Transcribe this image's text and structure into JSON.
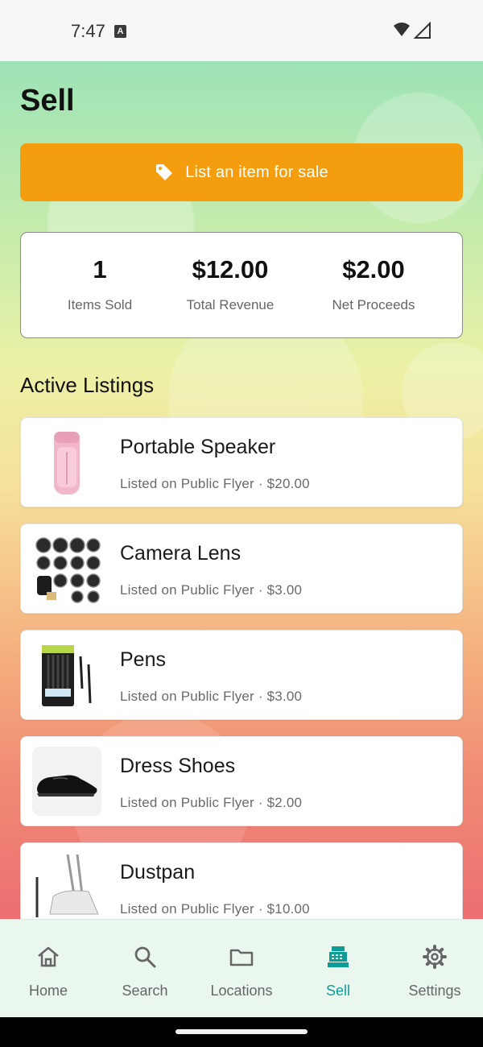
{
  "status_bar": {
    "time": "7:47",
    "notification_letter": "A"
  },
  "header": {
    "title": "Sell"
  },
  "cta": {
    "label": "List an item for sale",
    "color": "#f49e0f"
  },
  "stats": [
    {
      "value": "1",
      "label": "Items Sold"
    },
    {
      "value": "$12.00",
      "label": "Total Revenue"
    },
    {
      "value": "$2.00",
      "label": "Net Proceeds"
    }
  ],
  "section_title": "Active Listings",
  "listings": [
    {
      "title": "Portable Speaker",
      "subtitle": "Listed on Public Flyer · $20.00",
      "image": "pink-speaker"
    },
    {
      "title": "Camera Lens",
      "subtitle": "Listed on Public Flyer · $3.00",
      "image": "camera-lens-kit"
    },
    {
      "title": "Pens",
      "subtitle": "Listed on Public Flyer · $3.00",
      "image": "pen-pack"
    },
    {
      "title": "Dress Shoes",
      "subtitle": "Listed on Public Flyer · $2.00",
      "image": "black-dress-shoe"
    },
    {
      "title": "Dustpan",
      "subtitle": "Listed on Public Flyer · $10.00",
      "image": "dustpan-broom"
    }
  ],
  "bottom_nav": {
    "items": [
      {
        "label": "Home",
        "icon": "home-icon"
      },
      {
        "label": "Search",
        "icon": "search-icon"
      },
      {
        "label": "Locations",
        "icon": "folder-icon"
      },
      {
        "label": "Sell",
        "icon": "cash-register-icon",
        "active": true
      },
      {
        "label": "Settings",
        "icon": "gear-icon"
      }
    ],
    "active_color": "#0e9d96"
  }
}
